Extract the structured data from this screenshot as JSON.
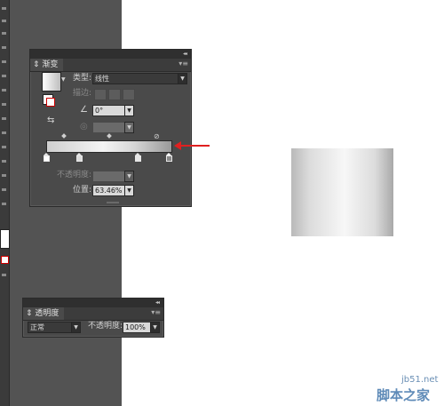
{
  "gradient_panel": {
    "tab_label": "渐变",
    "type_label": "类型:",
    "type_value": "线性",
    "stroke_label": "描边:",
    "angle_value": "0°",
    "opacity_label": "不透明度:",
    "opacity_value": "",
    "location_label": "位置:",
    "location_value": "63.46%",
    "stops": [
      {
        "color": "#ffffff"
      },
      {
        "color": "#dcdcdc"
      },
      {
        "color": "#e6e6e6"
      },
      {
        "color": "#8a8a8a"
      }
    ]
  },
  "transparency_panel": {
    "tab_label": "透明度",
    "blend_mode": "正常",
    "opacity_label": "不透明度:",
    "opacity_value": "100%"
  },
  "icons": {
    "menu": "panel-menu-icon",
    "collapse": "panel-collapse-icon",
    "angle": "angle-icon",
    "dropdown": "chevron-down-icon"
  },
  "colors": {
    "annotation_arrow": "#e02020",
    "panel_bg": "#4a4a4a",
    "canvas": "#ffffff"
  },
  "watermark": {
    "url": "jb51.net",
    "site": "脚本之家"
  }
}
